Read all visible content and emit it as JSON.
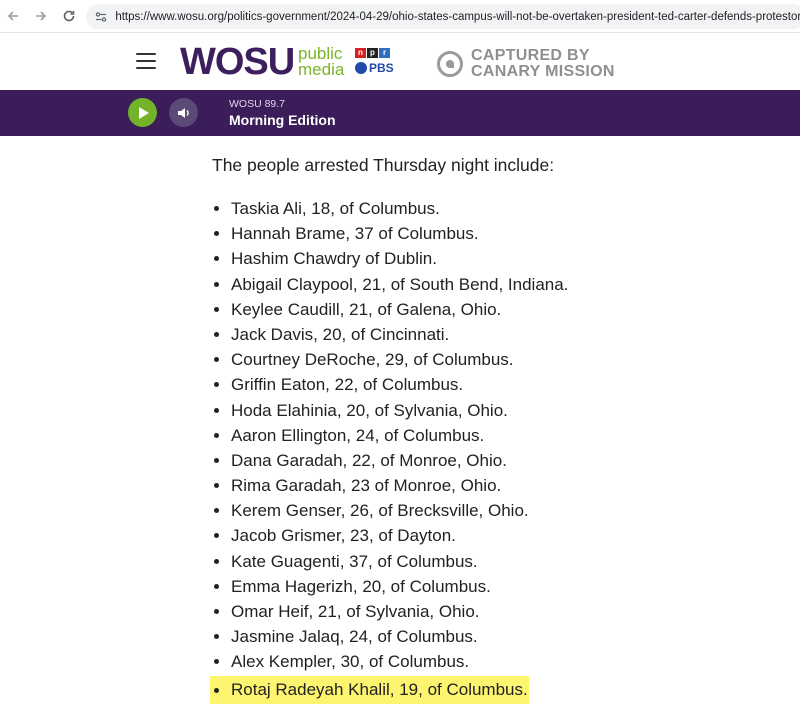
{
  "browser": {
    "url": "https://www.wosu.org/politics-government/2024-04-29/ohio-states-campus-will-not-be-overtaken-president-ted-carter-defends-protestor-arrests",
    "icons": [
      "back-arrow-icon",
      "forward-arrow-icon",
      "reload-icon",
      "site-settings-icon"
    ]
  },
  "header": {
    "logo_main": "WOSU",
    "logo_sub_1": "public",
    "logo_sub_2": "media",
    "npr_letters": [
      "n",
      "p",
      "r"
    ],
    "pbs": "PBS",
    "watermark_line1": "CAPTURED BY",
    "watermark_line2": "CANARY MISSION"
  },
  "player": {
    "station": "WOSU 89.7",
    "program": "Morning Edition"
  },
  "article": {
    "intro": "The people arrested Thursday night include:",
    "arrests": [
      "Taskia Ali, 18, of Columbus.",
      "Hannah Brame, 37 of Columbus.",
      "Hashim Chawdry of Dublin.",
      "Abigail Claypool, 21, of South Bend, Indiana.",
      "Keylee Caudill, 21, of Galena, Ohio.",
      "Jack Davis, 20, of Cincinnati.",
      "Courtney DeRoche, 29, of Columbus.",
      "Griffin Eaton, 22, of Columbus.",
      "Hoda Elahinia, 20, of Sylvania, Ohio.",
      "Aaron Ellington, 24, of Columbus.",
      "Dana Garadah, 22, of Monroe, Ohio.",
      "Rima Garadah, 23 of Monroe, Ohio.",
      "Kerem Genser, 26, of Brecksville, Ohio.",
      "Jacob Grismer, 23, of Dayton.",
      "Kate Guagenti, 37, of Columbus.",
      "Emma Hagerizh, 20, of Columbus.",
      "Omar Heif, 21, of Sylvania, Ohio.",
      "Jasmine Jalaq, 24, of Columbus.",
      "Alex Kempler, 30, of Columbus.",
      "Rotaj Radeyah Khalil, 19, of Columbus."
    ],
    "highlighted_index": 19,
    "highlight_color": "#fdf570"
  },
  "colors": {
    "brand_purple": "#3a1d59",
    "brand_green": "#72b32a"
  }
}
